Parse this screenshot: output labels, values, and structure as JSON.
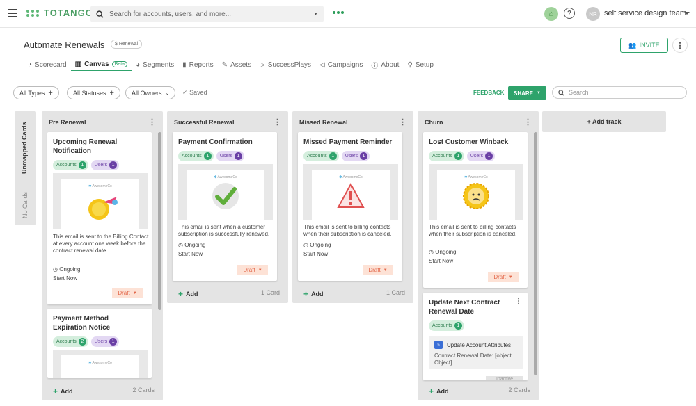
{
  "topbar": {
    "brand": "TOTANGO",
    "search_placeholder": "Search for accounts, users, and more...",
    "avatar_initials": "NR",
    "team": "self service design team"
  },
  "page": {
    "title": "Automate Renewals",
    "tag": "$ Renewal",
    "invite": "INVITE"
  },
  "tabs": [
    {
      "label": "Scorecard"
    },
    {
      "label": "Canvas",
      "badge": "Beta"
    },
    {
      "label": "Segments"
    },
    {
      "label": "Reports"
    },
    {
      "label": "Assets"
    },
    {
      "label": "SuccessPlays"
    },
    {
      "label": "Campaigns"
    },
    {
      "label": "About"
    },
    {
      "label": "Setup"
    }
  ],
  "filters": {
    "types": "All Types",
    "statuses": "All Statuses",
    "owners": "All Owners",
    "saved": "Saved",
    "feedback": "FEEDBACK",
    "share": "SHARE",
    "search_placeholder": "Search"
  },
  "unmapped": {
    "title": "Unmapped Cards",
    "empty": "No Cards"
  },
  "tracks": [
    {
      "name": "Pre Renewal",
      "count": "2 Cards",
      "add": "Add",
      "cards": [
        {
          "title": "Upcoming Renewal Notification",
          "accounts": "Accounts",
          "accounts_n": "1",
          "users": "Users",
          "users_n": "1",
          "brand": "AwesomeCo",
          "desc": "This email is sent to the Billing Contact at every account one week before the contract renewal date.",
          "status": "Ongoing",
          "start": "Start Now",
          "draft": "Draft"
        },
        {
          "title": "Payment Method Expiration Notice",
          "accounts": "Accounts",
          "accounts_n": "2",
          "users": "Users",
          "users_n": "1",
          "brand": "AwesomeCo"
        }
      ]
    },
    {
      "name": "Successful Renewal",
      "count": "1 Card",
      "add": "Add",
      "cards": [
        {
          "title": "Payment Confirmation",
          "accounts": "Accounts",
          "accounts_n": "1",
          "users": "Users",
          "users_n": "1",
          "brand": "AwesomeCo",
          "desc": "This email is sent when a customer subscription is successfully renewed.",
          "status": "Ongoing",
          "start": "Start Now",
          "draft": "Draft"
        }
      ]
    },
    {
      "name": "Missed Renewal",
      "count": "1 Card",
      "add": "Add",
      "cards": [
        {
          "title": "Missed Payment Reminder",
          "accounts": "Accounts",
          "accounts_n": "1",
          "users": "Users",
          "users_n": "1",
          "brand": "AwesomeCo",
          "desc": "This email is sent to billing contacts when their subscription is canceled.",
          "status": "Ongoing",
          "start": "Start Now",
          "draft": "Draft"
        }
      ]
    },
    {
      "name": "Churn",
      "count": "2 Cards",
      "add": "Add",
      "cards": [
        {
          "title": "Lost Customer Winback",
          "accounts": "Accounts",
          "accounts_n": "1",
          "users": "Users",
          "users_n": "1",
          "brand": "AwesomeCo",
          "desc": "This email is sent to billing contacts when their subscription is canceled.",
          "status": "Ongoing",
          "start": "Start Now",
          "draft": "Draft"
        },
        {
          "title": "Update Next Contract Renewal Date",
          "accounts": "Accounts",
          "accounts_n": "1",
          "action_title": "Update Account Attributes",
          "action_desc": "Contract Renewal Date: [object Object]",
          "state": "Inactive"
        }
      ]
    }
  ],
  "add_track": "+ Add track",
  "colors": {
    "accent": "#2ea36b",
    "users": "#6a3fa5",
    "draft": "#e2674a"
  }
}
